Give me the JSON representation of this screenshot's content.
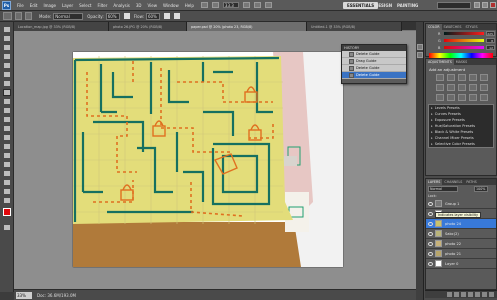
{
  "menubar": {
    "logo": "Ps",
    "items": [
      "File",
      "Edit",
      "Image",
      "Layer",
      "Select",
      "Filter",
      "Analysis",
      "3D",
      "View",
      "Window",
      "Help"
    ],
    "zoom": "33.3",
    "workspaces": [
      "ESSENTIALS",
      "DESIGN",
      "PAINTING"
    ]
  },
  "options": {
    "mode_label": "Mode:",
    "mode_value": "Normal",
    "opacity_label": "Opacity:",
    "opacity_value": "60%",
    "flow_label": "Flow:",
    "flow_value": "60%"
  },
  "tabs": [
    "Location_map.jpg @ 33% (RGB/8)",
    "photo 26.JPG @ 20% (RGB/8)",
    "paper.psd @ 20% (photo 23, RGB/8)",
    "Untitled-1 @ 33% (RGB/8)"
  ],
  "history": {
    "title": "HISTORY",
    "items": [
      "Delete Guide",
      "Drag Guide",
      "Delete Guide",
      "Delete Guide"
    ]
  },
  "color_panel": {
    "tabs": [
      "COLOR",
      "SWATCHES",
      "STYLES"
    ],
    "sliders": [
      {
        "label": "R",
        "value": "225",
        "color": "#e00000"
      },
      {
        "label": "G",
        "value": "8",
        "color": "#00b000"
      },
      {
        "label": "B",
        "value": "12",
        "color": "#0040e0"
      }
    ],
    "foreground": "#e1080c"
  },
  "adjustments": {
    "tabs": [
      "ADJUSTMENTS",
      "MASKS"
    ],
    "title": "Add an adjustment",
    "presets": [
      "Levels Presets",
      "Curves Presets",
      "Exposure Presets",
      "Hue/Saturation Presets",
      "Black & White Presets",
      "Channel Mixer Presets",
      "Selective Color Presets"
    ]
  },
  "layers": {
    "tabs": [
      "LAYERS",
      "CHANNELS",
      "PATHS"
    ],
    "blend": "Normal",
    "opacity": "100%",
    "lock_label": "Lock:",
    "tooltip": "Indicates layer visibility",
    "rows": [
      {
        "name": "Group 1",
        "thumb": "#777777",
        "selected": false
      },
      {
        "name": "Layer 1",
        "thumb": "#ffffff",
        "selected": false
      },
      {
        "name": "photo 24",
        "thumb": "#c9c26a",
        "selected": true
      },
      {
        "name": "Sabc(2)",
        "thumb": "#b9b47a",
        "selected": false
      },
      {
        "name": "photo 22",
        "thumb": "#c7b27a",
        "selected": false
      },
      {
        "name": "photo 21",
        "thumb": "#b8a66b",
        "selected": false
      },
      {
        "name": "Layer 0",
        "thumb": "#ffffff",
        "selected": false
      }
    ]
  },
  "status": {
    "zoom": "33%",
    "doc": "Doc: 36.6M/193.0M"
  }
}
